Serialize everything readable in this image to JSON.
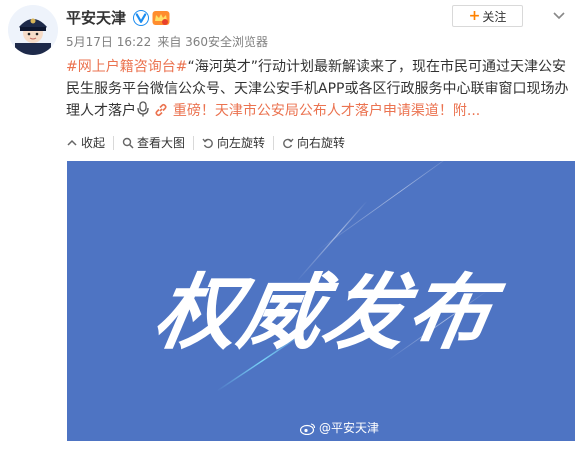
{
  "author": {
    "name": "平安天津",
    "verified_icon": "verified-v-badge",
    "member_icon": "member-badge"
  },
  "follow_button": {
    "label": "关注",
    "icon": "plus-icon"
  },
  "meta": {
    "time": "5月17日 16:22",
    "source": "来自 360安全浏览器"
  },
  "post": {
    "hashtag": "#网上户籍咨询台#",
    "text": "“海河英才”行动计划最新解读来了，现在市民可通过天津公安民生服务平台微信公众号、天津公安手机APP或各区行政服务中心联审窗口现场办理人才落户",
    "link_text": "重磅！天津市公安局公布人才落户申请渠道！附..."
  },
  "toolbar": {
    "collapse": "收起",
    "view_large": "查看大图",
    "rotate_left": "向左旋转",
    "rotate_right": "向右旋转"
  },
  "image": {
    "headline": "权威发布",
    "watermark": "@平安天津",
    "background_color": "#4e74c3"
  },
  "colors": {
    "accent": "#eb7350",
    "follow_plus": "#ff8200",
    "image_bg": "#4e74c3"
  }
}
